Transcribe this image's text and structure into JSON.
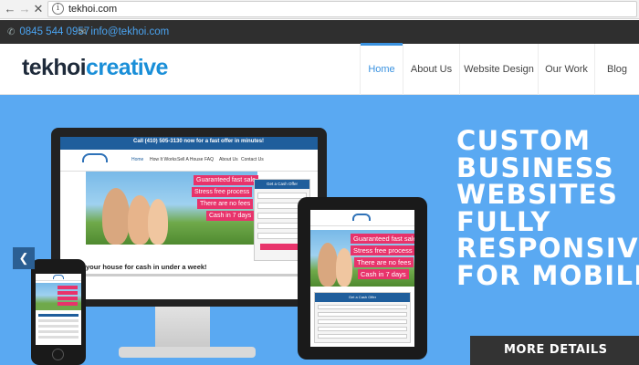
{
  "browser": {
    "back_icon": "arrow-left-icon",
    "forward_icon": "arrow-right-icon",
    "close_icon": "close-icon",
    "url": "tekhoi.com"
  },
  "topbar": {
    "phone": "0845 544 0957",
    "email": "info@tekhoi.com"
  },
  "header": {
    "logo_part1": "tekhoi",
    "logo_part2": "creative",
    "menu": [
      {
        "label": "Home",
        "active": true
      },
      {
        "label": "About Us",
        "active": false
      },
      {
        "label": "Website Design",
        "active": false
      },
      {
        "label": "Our Work",
        "active": false
      },
      {
        "label": "Blog",
        "active": false
      }
    ]
  },
  "hero": {
    "title_lines": [
      "CUSTOM",
      "BUSINESS",
      "WEBSITES",
      "FULLY",
      "RESPONSIVE",
      "FOR MOBILE"
    ],
    "cta": "MORE DETAILS"
  },
  "mockup": {
    "topline": "Call (410) 505-3130 now for a fast offer in minutes!",
    "nav": [
      "Home",
      "How It Works",
      "Sell A House",
      "FAQ",
      "About Us",
      "Contact Us"
    ],
    "badges": [
      "Guaranteed fast sale",
      "Stress free process",
      "There are no fees",
      "Cash in 7 days"
    ],
    "form_title": "Get a Cash Offer",
    "heading": "your house for cash in under a week!"
  },
  "colors": {
    "hero_bg": "#5aa9f2",
    "accent_blue": "#3a92e0",
    "topbar_bg": "#2f2f2f",
    "badge_pink": "#e8336b",
    "cta_bg": "#333333"
  }
}
